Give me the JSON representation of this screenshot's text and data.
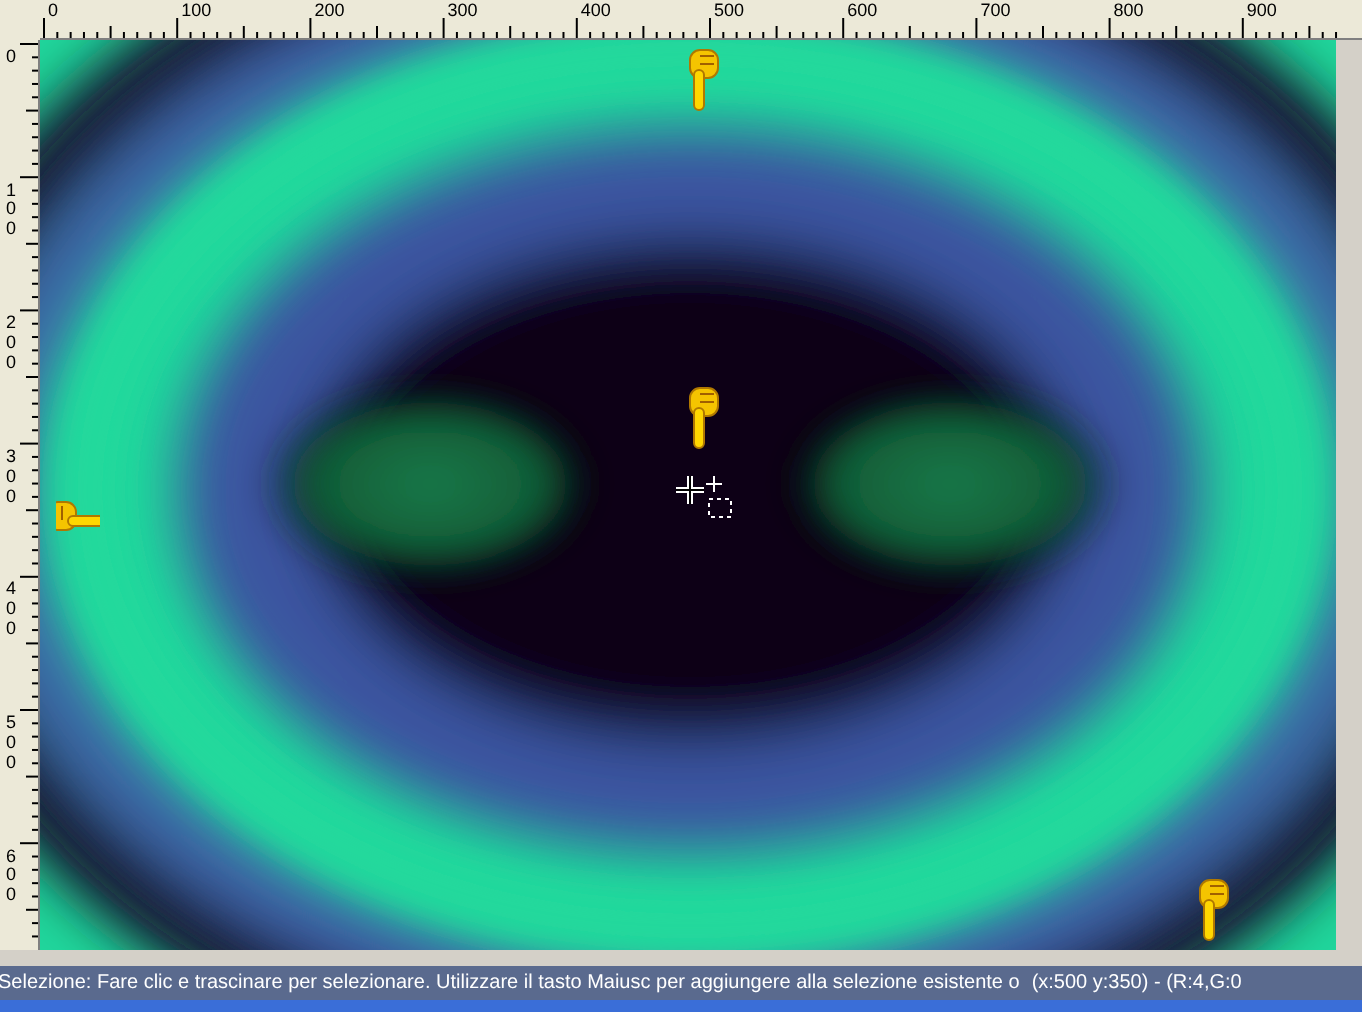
{
  "top_ruler": {
    "labels": [
      "0",
      "100",
      "200",
      "300",
      "400",
      "500",
      "600",
      "700",
      "800",
      "900"
    ]
  },
  "left_ruler": {
    "labels": [
      "0",
      "100",
      "200",
      "300",
      "400",
      "500",
      "600"
    ]
  },
  "status_bar": {
    "message": "Selezione: Fare clic e trascinare per selezionare. Utilizzare il tasto Maiusc per aggiungere alla selezione esistente o",
    "coordinates": "(x:500 y:350) - (R:4,G:0"
  }
}
